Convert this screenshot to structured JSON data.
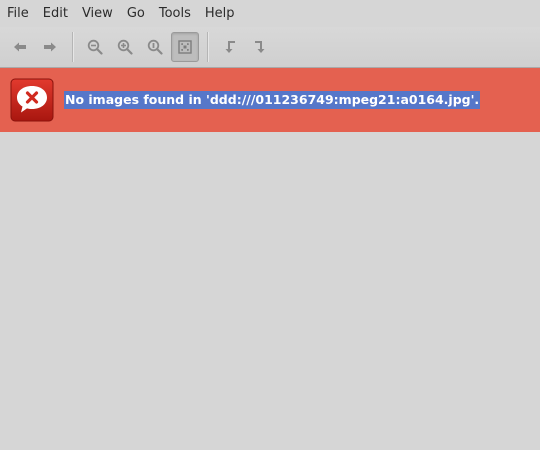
{
  "menubar": {
    "items": [
      "File",
      "Edit",
      "View",
      "Go",
      "Tools",
      "Help"
    ]
  },
  "toolbar": {
    "buttons": [
      {
        "name": "back-button",
        "icon": "arrow-left-icon"
      },
      {
        "name": "forward-button",
        "icon": "arrow-right-icon"
      },
      {
        "name": "zoom-out-button",
        "icon": "zoom-out-icon"
      },
      {
        "name": "zoom-in-button",
        "icon": "zoom-in-icon"
      },
      {
        "name": "zoom-normal-button",
        "icon": "zoom-original-icon"
      },
      {
        "name": "zoom-fit-button",
        "icon": "zoom-fit-icon",
        "active": true
      },
      {
        "name": "rotate-left-button",
        "icon": "rotate-left-icon"
      },
      {
        "name": "rotate-right-button",
        "icon": "rotate-right-icon"
      }
    ]
  },
  "error": {
    "icon": "error-speech-bubble-icon",
    "message": "No images found in 'ddd:///011236749:mpeg21:a0164.jpg'.",
    "background_color": "#e46150",
    "selection_color": "#5677c9"
  }
}
